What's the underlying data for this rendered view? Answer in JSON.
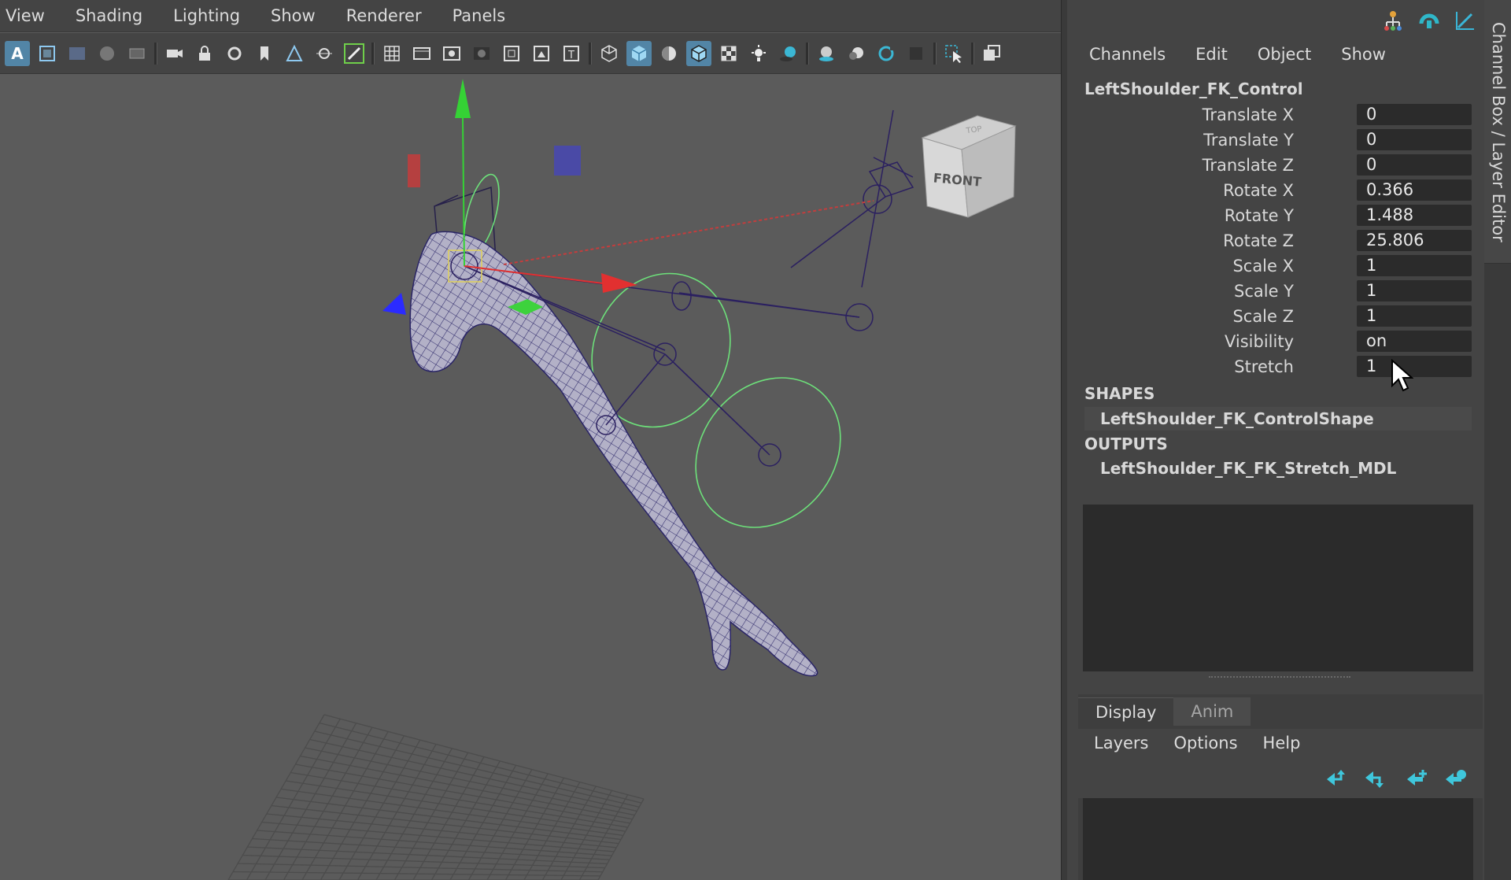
{
  "viewport": {
    "menus": [
      "View",
      "Shading",
      "Lighting",
      "Show",
      "Renderer",
      "Panels"
    ],
    "view_cube": {
      "face_front": "FRONT",
      "face_top": "TOP"
    }
  },
  "channel_box": {
    "menus": [
      "Channels",
      "Edit",
      "Object",
      "Show"
    ],
    "node_name": "LeftShoulder_FK_Control",
    "attributes": [
      {
        "label": "Translate X",
        "value": "0"
      },
      {
        "label": "Translate Y",
        "value": "0"
      },
      {
        "label": "Translate Z",
        "value": "0"
      },
      {
        "label": "Rotate X",
        "value": "0.366"
      },
      {
        "label": "Rotate Y",
        "value": "1.488"
      },
      {
        "label": "Rotate Z",
        "value": "25.806"
      },
      {
        "label": "Scale X",
        "value": "1"
      },
      {
        "label": "Scale Y",
        "value": "1"
      },
      {
        "label": "Scale Z",
        "value": "1"
      },
      {
        "label": "Visibility",
        "value": "on"
      },
      {
        "label": "Stretch",
        "value": "1"
      }
    ],
    "shapes_header": "SHAPES",
    "shape_node": "LeftShoulder_FK_ControlShape",
    "outputs_header": "OUTPUTS",
    "output_node": "LeftShoulder_FK_FK_Stretch_MDL"
  },
  "layer_editor": {
    "tabs": [
      "Display",
      "Anim"
    ],
    "menus": [
      "Layers",
      "Options",
      "Help"
    ]
  },
  "side_tab": {
    "label": "Channel Box / Layer Editor"
  },
  "colors": {
    "accent": "#5285a6",
    "field_bg": "#2b2b2b",
    "panel_bg": "#444444",
    "viewport_bg": "#5b5b5b"
  }
}
